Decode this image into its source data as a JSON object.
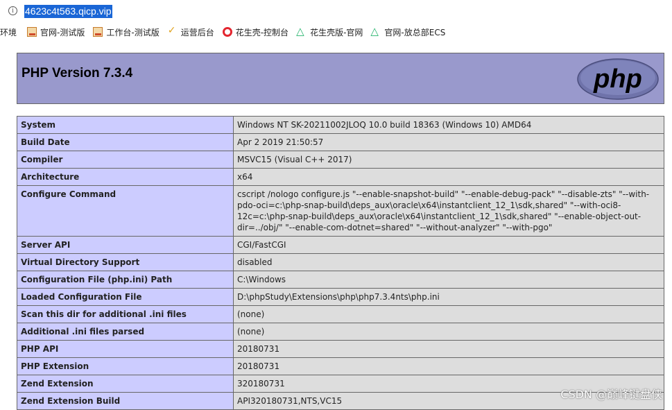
{
  "browser": {
    "url": "4623c4t563.qicp.vip",
    "bookmarks": [
      {
        "label": "环境",
        "icon": "none"
      },
      {
        "label": "官网-测试版",
        "icon": "page-icon"
      },
      {
        "label": "工作台-测试版",
        "icon": "page-icon"
      },
      {
        "label": "运营后台",
        "icon": "sprout-icon"
      },
      {
        "label": "花生壳-控制台",
        "icon": "ring-icon"
      },
      {
        "label": "花生壳版-官网",
        "icon": "triangle-icon"
      },
      {
        "label": "官网-放总部ECS",
        "icon": "triangle-icon"
      }
    ]
  },
  "php": {
    "title": "PHP Version 7.3.4",
    "logo_text": "php",
    "rows": [
      {
        "key": "System",
        "value": "Windows NT SK-20211002JLOQ 10.0 build 18363 (Windows 10) AMD64"
      },
      {
        "key": "Build Date",
        "value": "Apr 2 2019 21:50:57"
      },
      {
        "key": "Compiler",
        "value": "MSVC15 (Visual C++ 2017)"
      },
      {
        "key": "Architecture",
        "value": "x64"
      },
      {
        "key": "Configure Command",
        "value": "cscript /nologo configure.js \"--enable-snapshot-build\" \"--enable-debug-pack\" \"--disable-zts\" \"--with-pdo-oci=c:\\php-snap-build\\deps_aux\\oracle\\x64\\instantclient_12_1\\sdk,shared\" \"--with-oci8-12c=c:\\php-snap-build\\deps_aux\\oracle\\x64\\instantclient_12_1\\sdk,shared\" \"--enable-object-out-dir=../obj/\" \"--enable-com-dotnet=shared\" \"--without-analyzer\" \"--with-pgo\""
      },
      {
        "key": "Server API",
        "value": "CGI/FastCGI"
      },
      {
        "key": "Virtual Directory Support",
        "value": "disabled"
      },
      {
        "key": "Configuration File (php.ini) Path",
        "value": "C:\\Windows"
      },
      {
        "key": "Loaded Configuration File",
        "value": "D:\\phpStudy\\Extensions\\php\\php7.3.4nts\\php.ini"
      },
      {
        "key": "Scan this dir for additional .ini files",
        "value": "(none)"
      },
      {
        "key": "Additional .ini files parsed",
        "value": "(none)"
      },
      {
        "key": "PHP API",
        "value": "20180731"
      },
      {
        "key": "PHP Extension",
        "value": "20180731"
      },
      {
        "key": "Zend Extension",
        "value": "320180731"
      },
      {
        "key": "Zend Extension Build",
        "value": "API320180731,NTS,VC15"
      }
    ]
  },
  "watermark": "CSDN @巅峰键盘侠"
}
